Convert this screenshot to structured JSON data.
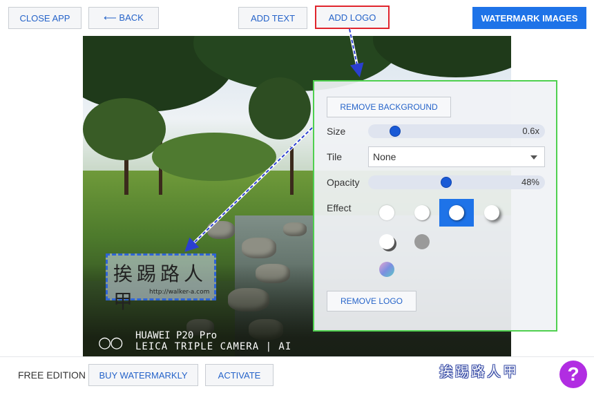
{
  "toolbar": {
    "close_label": "CLOSE APP",
    "back_label": "⟵ BACK",
    "add_text_label": "ADD TEXT",
    "add_logo_label": "ADD LOGO",
    "watermark_label": "WATERMARK IMAGES"
  },
  "panel": {
    "remove_bg_label": "REMOVE BACKGROUND",
    "size_label": "Size",
    "size_value": "0.6x",
    "size_level": 0.1,
    "tile_label": "Tile",
    "tile_value": "None",
    "opacity_label": "Opacity",
    "opacity_value": "48%",
    "opacity_level": 0.48,
    "effect_label": "Effect",
    "effects_selected": "shadow-3",
    "remove_logo_label": "REMOVE LOGO"
  },
  "photo": {
    "logo_text": "挨踢路人甲",
    "logo_url": "http://walker-a.com",
    "camera_line1": "HUAWEI P20 Pro",
    "camera_line2": "LEICA TRIPLE CAMERA | AI",
    "camera_circles": "○○"
  },
  "footer": {
    "edition_label": "FREE EDITION",
    "buy_label": "BUY WATERMARKLY",
    "activate_label": "ACTIVATE",
    "corner_watermark": "挨踢路人甲",
    "help_label": "?"
  },
  "colors": {
    "accent": "#1e73e8",
    "highlight_red": "#e0242c",
    "panel_border_green": "#4ed04e",
    "help_purple": "#b12de2"
  },
  "icons": [
    "back-arrow-icon",
    "dropdown-caret-icon",
    "help-icon"
  ]
}
